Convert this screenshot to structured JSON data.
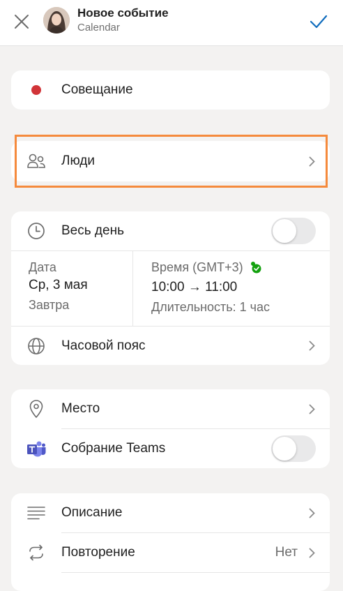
{
  "header": {
    "title": "Новое событие",
    "subtitle": "Calendar"
  },
  "event": {
    "name": "Совещание",
    "color": "#d13438"
  },
  "people": {
    "label": "Люди"
  },
  "all_day": {
    "label": "Весь день",
    "on": false
  },
  "date": {
    "label": "Дата",
    "value": "Ср, 3 мая",
    "relative": "Завтра"
  },
  "time": {
    "label": "Время (GMT+3)",
    "value": "10:00 → 11:00",
    "duration": "Длительность: 1 час"
  },
  "timezone": {
    "label": "Часовой пояс"
  },
  "location": {
    "label": "Место"
  },
  "teams": {
    "label": "Собрание Teams",
    "on": false
  },
  "description": {
    "label": "Описание"
  },
  "repeat": {
    "label": "Повторение",
    "value": "Нет"
  },
  "colors": {
    "accent": "#0f6cbd",
    "highlight": "#f58a3c",
    "teams": "#5b5fc7",
    "status_green": "#13a10e"
  }
}
